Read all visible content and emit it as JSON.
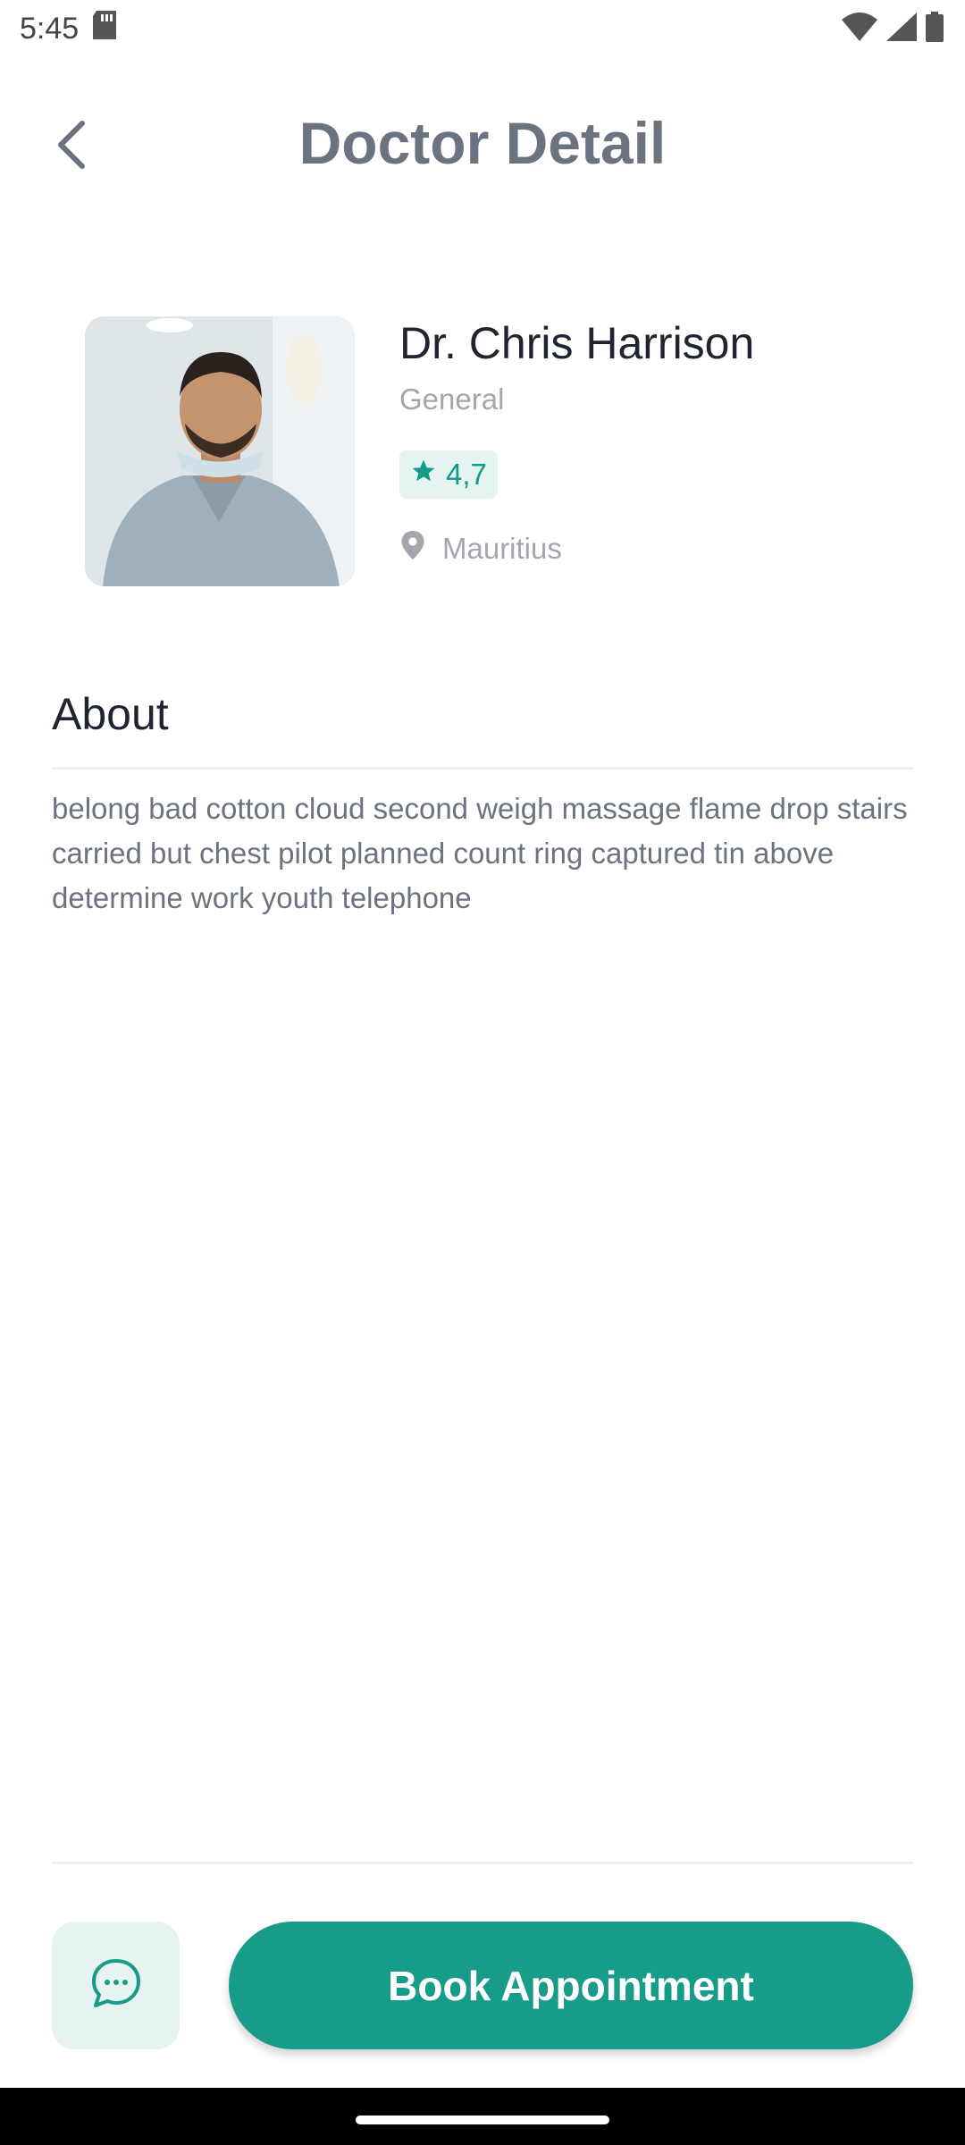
{
  "status_bar": {
    "time": "5:45",
    "icons": [
      "sd-card-icon",
      "wifi-icon",
      "signal-icon",
      "battery-icon"
    ]
  },
  "header": {
    "back_icon": "chevron-left-icon",
    "title": "Doctor Detail"
  },
  "doctor": {
    "name": "Dr. Chris Harrison",
    "specialty": "General",
    "rating": "4,7",
    "location": "Mauritius",
    "photo_icon": "doctor-photo"
  },
  "about": {
    "title": "About",
    "text": "belong bad cotton cloud second weigh massage flame drop stairs carried but chest pilot planned count ring captured tin above determine work youth telephone"
  },
  "actions": {
    "chat_icon": "chat-bubble-icon",
    "book_label": "Book Appointment"
  },
  "colors": {
    "accent": "#179c8a",
    "accent_light": "#e6f4f1",
    "title_gray": "#6b7280",
    "muted": "#a3a7ad"
  }
}
